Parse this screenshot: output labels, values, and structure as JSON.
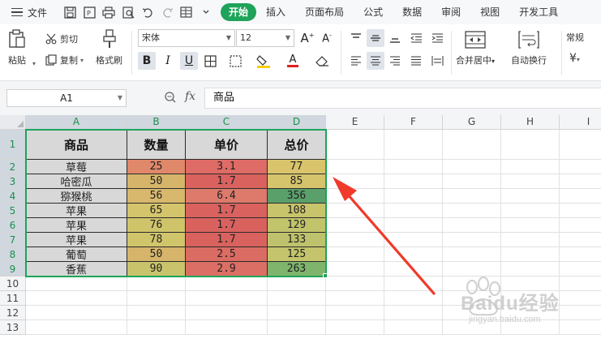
{
  "menu": {
    "file_label": "文件",
    "tabs": [
      {
        "label": "开始",
        "active": true
      },
      {
        "label": "插入",
        "active": false
      },
      {
        "label": "页面布局",
        "active": false
      },
      {
        "label": "公式",
        "active": false
      },
      {
        "label": "数据",
        "active": false
      },
      {
        "label": "审阅",
        "active": false
      },
      {
        "label": "视图",
        "active": false
      },
      {
        "label": "开发工具",
        "active": false
      }
    ]
  },
  "ribbon": {
    "paste": "粘贴",
    "cut": "剪切",
    "copy": "复制",
    "format_painter": "格式刷",
    "font_name": "宋体",
    "font_size": "12",
    "merge_center": "合并居中",
    "wrap_text": "自动换行",
    "number_format": "常规",
    "currency_symbol": "¥",
    "bold": "B",
    "italic": "I",
    "underline": "U",
    "font_color_letter": "A"
  },
  "formula_bar": {
    "cell_ref": "A1",
    "fx": "fx",
    "content": "商品"
  },
  "sheet": {
    "columns": [
      "A",
      "B",
      "C",
      "D",
      "E",
      "F",
      "G",
      "H",
      "I"
    ],
    "rows": [
      "1",
      "2",
      "3",
      "4",
      "5",
      "6",
      "7",
      "8",
      "9",
      "10",
      "11",
      "12",
      "13"
    ],
    "table_header": [
      "商品",
      "数量",
      "单价",
      "总价"
    ],
    "table_rows": [
      {
        "product": "草莓",
        "qty": "25",
        "price": "3.1",
        "total": "77"
      },
      {
        "product": "哈密瓜",
        "qty": "50",
        "price": "1.7",
        "total": "85"
      },
      {
        "product": "猕猴桃",
        "qty": "56",
        "price": "6.4",
        "total": "356"
      },
      {
        "product": "苹果",
        "qty": "65",
        "price": "1.7",
        "total": "108"
      },
      {
        "product": "苹果",
        "qty": "76",
        "price": "1.7",
        "total": "129"
      },
      {
        "product": "苹果",
        "qty": "78",
        "price": "1.7",
        "total": "133"
      },
      {
        "product": "葡萄",
        "qty": "50",
        "price": "2.5",
        "total": "125"
      },
      {
        "product": "香蕉",
        "qty": "90",
        "price": "2.9",
        "total": "263"
      }
    ],
    "colors": {
      "header_bg": "#d8d8d8",
      "product_bg": "#d8d8d8",
      "qty": [
        "#e0886a",
        "#d6b56b",
        "#d7b86d",
        "#d4c46c",
        "#cfc46a",
        "#d0c56b",
        "#d6b56b",
        "#c9c46b"
      ],
      "price": [
        "#df6b66",
        "#d9625f",
        "#dd7a6b",
        "#d9625f",
        "#d9625f",
        "#d9625f",
        "#db6c63",
        "#dc6f65"
      ],
      "total": [
        "#d9c46c",
        "#d5c46b",
        "#5aa06a",
        "#c8c46b",
        "#c2c46c",
        "#bec26c",
        "#c4c46c",
        "#7eb46c"
      ],
      "selection": "#1ea45a",
      "arrow": "#f03a2a"
    }
  },
  "watermark": {
    "text_main": "Baidu经验",
    "text_sub": "jingyan.baidu.com"
  }
}
